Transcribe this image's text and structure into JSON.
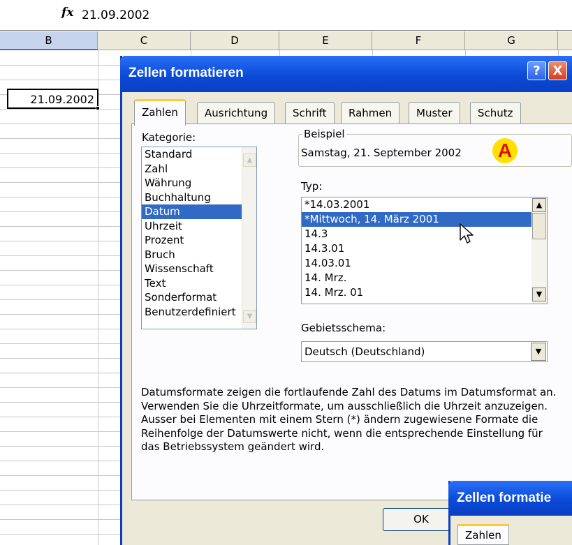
{
  "formula_bar": {
    "fx_symbol": "fx",
    "value": "21.09.2002"
  },
  "columns": [
    "B",
    "C",
    "D",
    "E",
    "F",
    "G"
  ],
  "active_cell": {
    "value": "21.09.2002"
  },
  "dialog": {
    "title": "Zellen formatieren",
    "help_label": "?",
    "close_label": "X",
    "tabs": [
      "Zahlen",
      "Ausrichtung",
      "Schrift",
      "Rahmen",
      "Muster",
      "Schutz"
    ],
    "active_tab": "Zahlen",
    "kategorie_label": "Kategorie:",
    "kategorien": [
      "Standard",
      "Zahl",
      "Währung",
      "Buchhaltung",
      "Datum",
      "Uhrzeit",
      "Prozent",
      "Bruch",
      "Wissenschaft",
      "Text",
      "Sonderformat",
      "Benutzerdefiniert"
    ],
    "selected_kategorie": "Datum",
    "beispiel_label": "Beispiel",
    "beispiel_value": "Samstag, 21. September 2002",
    "marker": "A",
    "typ_label": "Typ:",
    "typen": [
      "*14.03.2001",
      "*Mittwoch, 14. März 2001",
      "14.3",
      "14.3.01",
      "14.03.01",
      "14. Mrz.",
      "14. Mrz. 01"
    ],
    "selected_typ": "*Mittwoch, 14. März 2001",
    "gebiet_label": "Gebietsschema:",
    "gebiet_value": "Deutsch (Deutschland)",
    "description": "Datumsformate zeigen die fortlaufende Zahl des Datums im Datumsformat an. Verwenden Sie die Uhrzeitformate, um ausschließlich die Uhrzeit anzuzeigen. Ausser bei Elementen mit einem Stern (*) ändern zugewiesene Formate die Reihenfolge der Datumswerte nicht, wenn die entsprechende Einstellung für das Betriebssystem geändert wird.",
    "ok_label": "OK"
  },
  "dialog2": {
    "title": "Zellen formatie",
    "tab_label": "Zahlen"
  }
}
